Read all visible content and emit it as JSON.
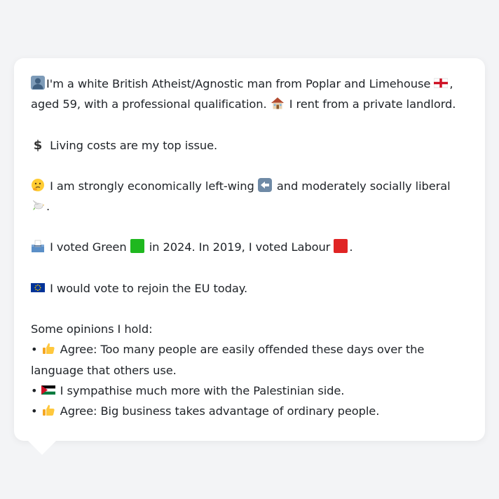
{
  "profile": {
    "intro_a": "I'm a white British Atheist/Agnostic man from Poplar and Limehouse",
    "intro_b": ",",
    "intro_c": "aged 59, with a professional qualification.",
    "intro_d": "I rent from a private landlord.",
    "issue": "Living costs are my top issue.",
    "ideology_a": "I am strongly economically left-wing",
    "ideology_b": "and moderately socially liberal",
    "ideology_c": ".",
    "vote_a": "I voted Green",
    "vote_b": "in 2024. In 2019, I voted Labour",
    "vote_c": ".",
    "eu": "I would vote to rejoin the EU today.",
    "opinions_header": "Some opinions I hold:",
    "bullet": "•",
    "opinion_1": "Agree: Too many people are easily offended these days over the language that others use.",
    "opinion_2": "I sympathise much more with the Palestinian side.",
    "opinion_3": "Agree: Big business takes advantage of ordinary people."
  },
  "icons": {
    "person": "person-icon",
    "england_flag": "england-flag-icon",
    "house": "house-icon",
    "dollar": "dollar-icon",
    "thinking": "thinking-face-icon",
    "left_arrow": "left-arrow-icon",
    "dove": "dove-icon",
    "ballot": "ballot-box-icon",
    "green_square": "green-square-icon",
    "red_square": "red-square-icon",
    "eu_flag": "eu-flag-icon",
    "thumbs_up": "thumbs-up-icon",
    "palestine_flag": "palestine-flag-icon"
  },
  "colors": {
    "background": "#f3f4f6",
    "card": "#ffffff",
    "text": "#1f2328",
    "green": "#1fb81f",
    "red": "#e02424"
  }
}
